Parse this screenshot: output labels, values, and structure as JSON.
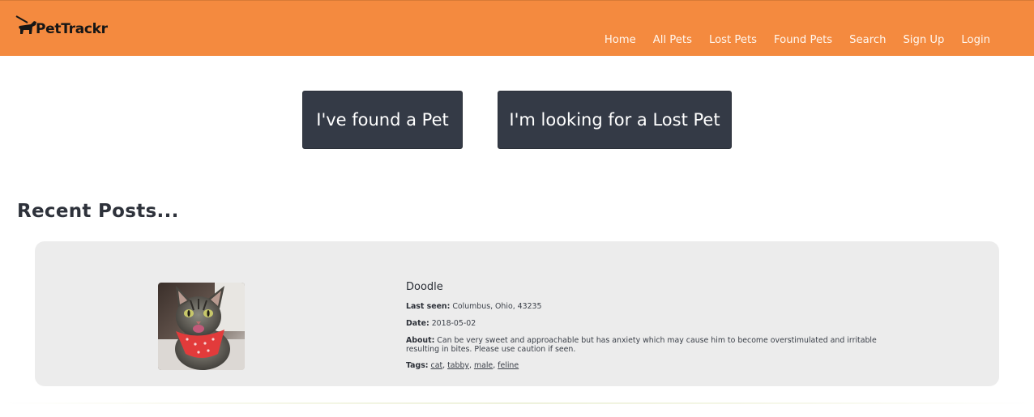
{
  "navbar": {
    "brand": "PetTrackr",
    "links": [
      "Home",
      "All Pets",
      "Lost Pets",
      "Found Pets",
      "Search",
      "Sign Up",
      "Login"
    ],
    "background": "#f48a3f"
  },
  "actions": {
    "found_label": "I've found a Pet",
    "lost_label": "I'm looking for a Lost Pet",
    "button_color": "#343a46"
  },
  "recent": {
    "title": "Recent Posts...",
    "posts": [
      {
        "name": "Doodle",
        "last_seen_label": "Last seen:",
        "last_seen": "Columbus, Ohio, 43235",
        "date_label": "Date:",
        "date": "2018-05-02",
        "about_label": "About:",
        "about": "Can be very sweet and approachable but has anxiety which may cause him to become overstimulated and irritable resulting in bites. Please use caution if seen.",
        "tags_label": "Tags:",
        "tags": [
          "cat",
          "tabby",
          "male",
          "feline"
        ],
        "photo": "tabby-cat-with-red-bandana"
      }
    ]
  }
}
